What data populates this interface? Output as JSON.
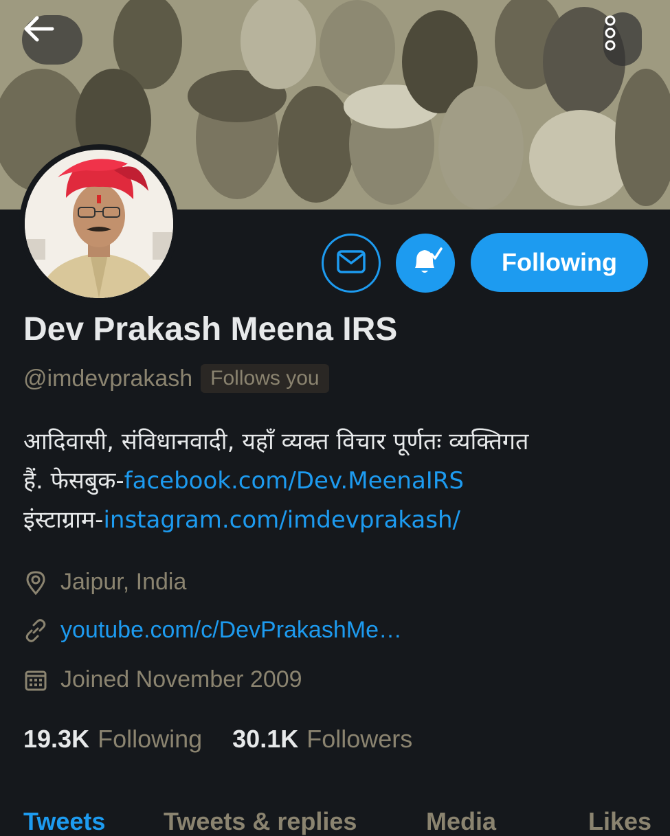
{
  "header": {
    "back_icon": "arrow-left-icon",
    "more_icon": "more-vertical-icon"
  },
  "profile": {
    "name": "Dev Prakash Meena IRS",
    "handle": "@imdevprakash",
    "follows_you": "Follows you",
    "bio": {
      "line1": "आदिवासी, संविधानवादी, यहाँ व्यक्त विचार पूर्णतः व्यक्तिगत",
      "line2_prefix": "हैं. फेसबुक-",
      "line2_link": "facebook.com/Dev.MeenaIRS",
      "line3_prefix": "इंस्टाग्राम-",
      "line3_link": "instagram.com/imdevprakash/"
    },
    "location": "Jaipur, India",
    "website": "youtube.com/c/DevPrakashMe…",
    "joined": "Joined November 2009"
  },
  "actions": {
    "message_icon": "envelope-icon",
    "notify_icon": "bell-check-icon",
    "following_label": "Following"
  },
  "stats": {
    "following_count": "19.3K",
    "following_label": "Following",
    "followers_count": "30.1K",
    "followers_label": "Followers"
  },
  "tabs": [
    {
      "label": "Tweets",
      "active": true
    },
    {
      "label": "Tweets & replies",
      "active": false
    },
    {
      "label": "Media",
      "active": false
    },
    {
      "label": "Likes",
      "active": false
    }
  ],
  "colors": {
    "accent": "#1d9bf0",
    "background": "#15181c",
    "muted": "#8b8470"
  }
}
